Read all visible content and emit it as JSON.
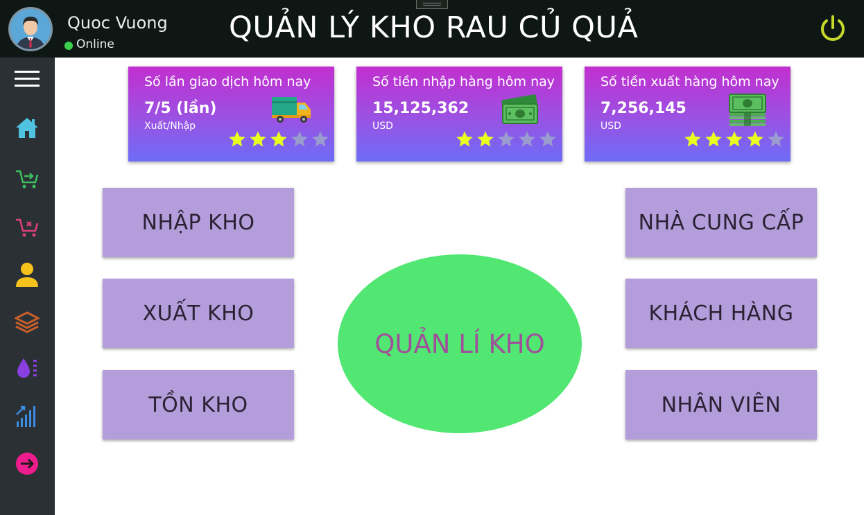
{
  "header": {
    "app_title": "QUẢN LÝ KHO RAU CỦ QUẢ",
    "user_name": "Quoc Vuong",
    "status": "Online",
    "power_icon": "power-icon"
  },
  "sidebar": {
    "items": [
      {
        "icon": "hamburger-menu-icon"
      },
      {
        "icon": "home-icon"
      },
      {
        "icon": "cart-import-icon"
      },
      {
        "icon": "cart-remove-icon"
      },
      {
        "icon": "user-icon"
      },
      {
        "icon": "layers-icon"
      },
      {
        "icon": "water-drop-icon"
      },
      {
        "icon": "signal-bars-icon"
      },
      {
        "icon": "logout-icon"
      }
    ]
  },
  "cards": [
    {
      "title": "Số lần giao dịch hôm nay",
      "value": "7/5 (lần)",
      "unit": "Xuất/Nhập",
      "icon": "truck-icon",
      "rating": 3,
      "rating_max": 5
    },
    {
      "title": "Số tiền nhập hàng hôm nay",
      "value": "15,125,362",
      "unit": "USD",
      "icon": "money-icon",
      "rating": 2,
      "rating_max": 5
    },
    {
      "title": "Số tiền xuất hàng hôm nay",
      "value": "7,256,145",
      "unit": "USD",
      "icon": "money-stack-icon",
      "rating": 4,
      "rating_max": 5
    }
  ],
  "buttons": {
    "import": "NHẬP KHO",
    "export": "XUẤT KHO",
    "stock": "TỒN KHO",
    "supplier": "NHÀ CUNG CẤP",
    "customer": "KHÁCH HÀNG",
    "staff": "NHÂN VIÊN"
  },
  "center": {
    "label": "QUẢN LÍ KHO"
  },
  "colors": {
    "topbar": "#0e1714",
    "sidebar": "#2b3035",
    "button": "#b39ddb",
    "oval": "#52e772",
    "oval_text": "#a04f9a",
    "star_on": "#e9ff1f",
    "star_off": "#9a9ccf",
    "online": "#3ccf4e",
    "power": "#c6d92a"
  }
}
